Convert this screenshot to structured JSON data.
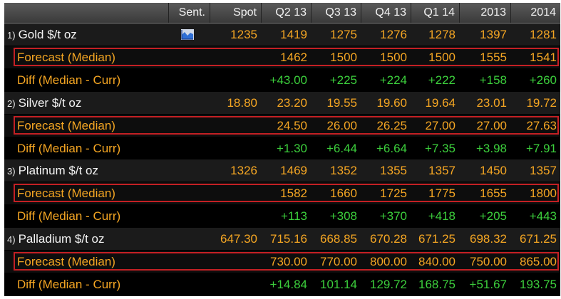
{
  "colors": {
    "background": "#000000",
    "header": "#4a4a4a",
    "amber": "#f5a623",
    "green": "#3ccf3c",
    "highlight_box": "#c42024"
  },
  "header": {
    "columns": [
      "Sent.",
      "Spot",
      "Q2 13",
      "Q3 13",
      "Q4 13",
      "Q1 14",
      "2013",
      "2014"
    ]
  },
  "rows": [
    {
      "kind": "metal",
      "index": "1)",
      "label": "Gold $/t oz",
      "sentiment_icon": "chart-icon",
      "values": [
        "1235",
        "1419",
        "1275",
        "1276",
        "1278",
        "1397",
        "1281"
      ]
    },
    {
      "kind": "forecast",
      "label": "Forecast (Median)",
      "values": [
        "",
        "1462",
        "1500",
        "1500",
        "1500",
        "1555",
        "1541"
      ]
    },
    {
      "kind": "diff",
      "label": "Diff (Median - Curr)",
      "values": [
        "",
        "+43.00",
        "+225",
        "+224",
        "+222",
        "+158",
        "+260"
      ]
    },
    {
      "kind": "metal",
      "index": "2)",
      "label": "Silver $/t oz",
      "values": [
        "18.80",
        "23.20",
        "19.55",
        "19.60",
        "19.64",
        "23.01",
        "19.72"
      ]
    },
    {
      "kind": "forecast",
      "label": "Forecast (Median)",
      "values": [
        "",
        "24.50",
        "26.00",
        "26.25",
        "27.00",
        "27.00",
        "27.63"
      ]
    },
    {
      "kind": "diff",
      "label": "Diff (Median - Curr)",
      "values": [
        "",
        "+1.30",
        "+6.44",
        "+6.64",
        "+7.35",
        "+3.98",
        "+7.91"
      ]
    },
    {
      "kind": "metal",
      "index": "3)",
      "label": "Platinum $/t oz",
      "values": [
        "1326",
        "1469",
        "1352",
        "1355",
        "1357",
        "1450",
        "1357"
      ]
    },
    {
      "kind": "forecast",
      "label": "Forecast (Median)",
      "values": [
        "",
        "1582",
        "1660",
        "1725",
        "1775",
        "1655",
        "1800"
      ]
    },
    {
      "kind": "diff",
      "label": "Diff (Median - Curr)",
      "values": [
        "",
        "+113",
        "+308",
        "+370",
        "+418",
        "+205",
        "+443"
      ]
    },
    {
      "kind": "metal",
      "index": "4)",
      "label": "Palladium $/t oz",
      "values": [
        "647.30",
        "715.16",
        "668.85",
        "670.28",
        "671.25",
        "698.32",
        "671.25"
      ]
    },
    {
      "kind": "forecast",
      "label": "Forecast (Median)",
      "values": [
        "",
        "730.00",
        "770.00",
        "800.00",
        "840.00",
        "750.00",
        "865.00"
      ]
    },
    {
      "kind": "diff",
      "label": "Diff (Median - Curr)",
      "values": [
        "",
        "+14.84",
        "101.14",
        "129.72",
        "168.75",
        "+51.67",
        "193.75"
      ]
    }
  ]
}
